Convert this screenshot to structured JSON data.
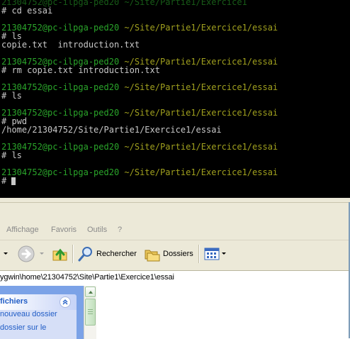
{
  "terminal": {
    "top_partial": "2i304752@pc-ilpga-ped20 ~/Site/Partie1/Exercice1",
    "lines": [
      {
        "kind": "cmd",
        "text": "# cd essai"
      },
      {
        "kind": "blank",
        "text": ""
      },
      {
        "kind": "prompt",
        "user": "21304752@pc-ilpga-ped20",
        "path": "~/Site/Partie1/Exercice1/essai"
      },
      {
        "kind": "cmd",
        "text": "# ls"
      },
      {
        "kind": "out",
        "text": "copie.txt  introduction.txt"
      },
      {
        "kind": "blank",
        "text": ""
      },
      {
        "kind": "prompt",
        "user": "21304752@pc-ilpga-ped20",
        "path": "~/Site/Partie1/Exercice1/essai"
      },
      {
        "kind": "cmd",
        "text": "# rm copie.txt introduction.txt"
      },
      {
        "kind": "blank",
        "text": ""
      },
      {
        "kind": "prompt",
        "user": "21304752@pc-ilpga-ped20",
        "path": "~/Site/Partie1/Exercice1/essai"
      },
      {
        "kind": "cmd",
        "text": "# ls"
      },
      {
        "kind": "blank",
        "text": ""
      },
      {
        "kind": "prompt",
        "user": "21304752@pc-ilpga-ped20",
        "path": "~/Site/Partie1/Exercice1/essai"
      },
      {
        "kind": "cmd",
        "text": "# pwd"
      },
      {
        "kind": "out",
        "text": "/home/21304752/Site/Partie1/Exercice1/essai"
      },
      {
        "kind": "blank",
        "text": ""
      },
      {
        "kind": "prompt",
        "user": "21304752@pc-ilpga-ped20",
        "path": "~/Site/Partie1/Exercice1/essai"
      },
      {
        "kind": "cmd",
        "text": "# ls"
      },
      {
        "kind": "blank",
        "text": ""
      },
      {
        "kind": "prompt",
        "user": "21304752@pc-ilpga-ped20",
        "path": "~/Site/Partie1/Exercice1/essai"
      },
      {
        "kind": "cmd",
        "text": "# "
      }
    ],
    "colors": {
      "user": "#2aa52a",
      "path": "#a0a01e",
      "text": "#c8c8c8",
      "background": "#000000"
    }
  },
  "explorer": {
    "menu": [
      "Affichage",
      "Favoris",
      "Outils",
      "?"
    ],
    "toolbar": {
      "back_icon": "back-arrow-icon",
      "forward_icon": "forward-arrow-icon",
      "up_icon": "up-folder-icon",
      "search_label": "Rechercher",
      "folders_label": "Dossiers",
      "views_icon": "views-icon"
    },
    "address": "ygwin\\home\\21304752\\Site\\Partie1\\Exercice1\\essai",
    "taskpane": {
      "title": "fichiers",
      "links": [
        "nouveau dossier",
        "dossier sur le"
      ]
    }
  }
}
